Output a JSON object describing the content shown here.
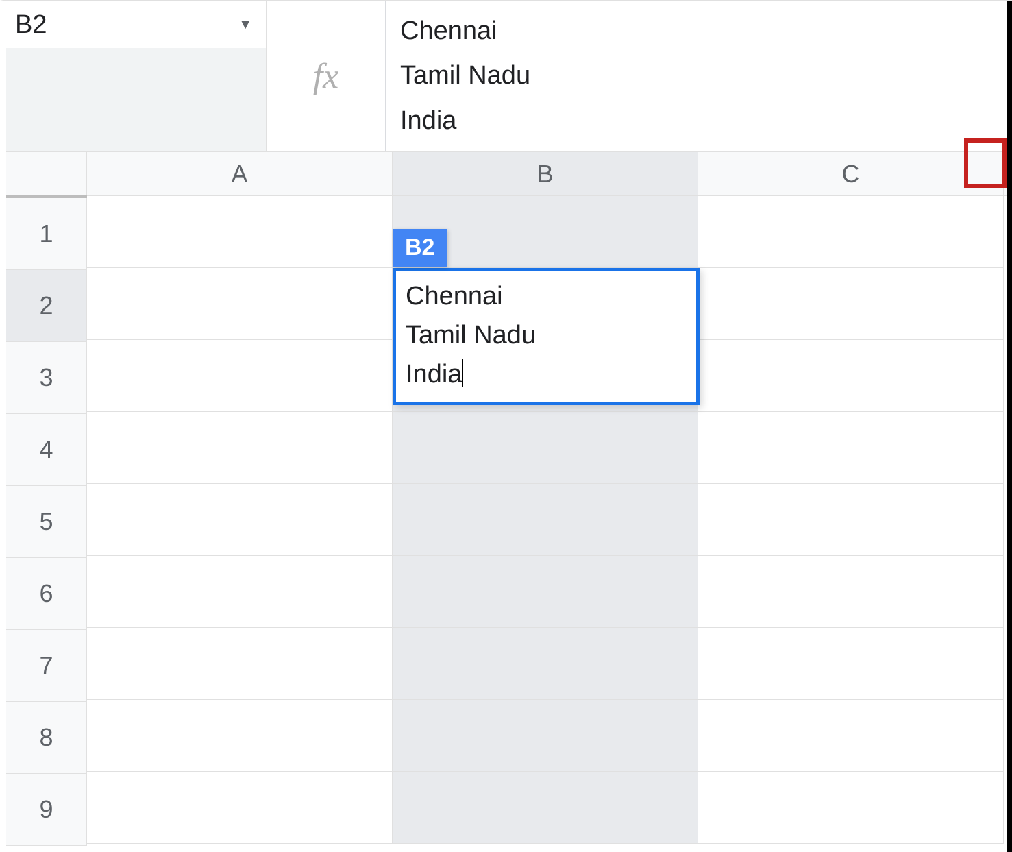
{
  "name_box": {
    "value": "B2"
  },
  "formula_bar": {
    "content": "Chennai\nTamil Nadu\nIndia"
  },
  "columns": [
    "A",
    "B",
    "C"
  ],
  "rows": [
    "1",
    "2",
    "3",
    "4",
    "5",
    "6",
    "7",
    "8",
    "9"
  ],
  "active_cell": {
    "label": "B2",
    "lines": [
      "Chennai",
      "Tamil Nadu",
      "India"
    ]
  }
}
